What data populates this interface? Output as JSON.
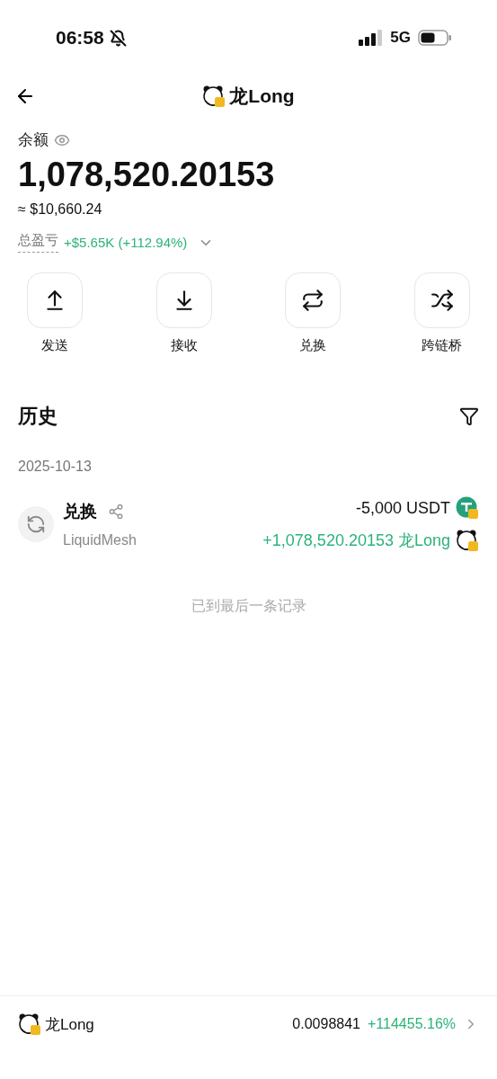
{
  "status_bar": {
    "time": "06:58",
    "network": "5G",
    "muted": true
  },
  "header": {
    "title": "龙Long"
  },
  "balance": {
    "label": "余额",
    "amount": "1,078,520.20153",
    "fiat": "≈ $10,660.24",
    "pnl_label": "总盈亏",
    "pnl": "+$5.65K (+112.94%)"
  },
  "actions": [
    {
      "kind": "send",
      "label": "发送"
    },
    {
      "kind": "receive",
      "label": "接收"
    },
    {
      "kind": "swap",
      "label": "兑换"
    },
    {
      "kind": "bridge",
      "label": "跨链桥"
    }
  ],
  "history": {
    "title": "历史",
    "groups": [
      {
        "date": "2025-10-13",
        "items": [
          {
            "title": "兑换",
            "source": "LiquidMesh",
            "out": {
              "amount": "-5,000 USDT",
              "kind": "usdt"
            },
            "in": {
              "amount": "+1,078,520.20153 龙Long",
              "kind": "long"
            }
          }
        ]
      }
    ],
    "end_note": "已到最后一条记录"
  },
  "footer": {
    "name": "龙Long",
    "price": "0.0098841",
    "change": "+114455.16%"
  }
}
